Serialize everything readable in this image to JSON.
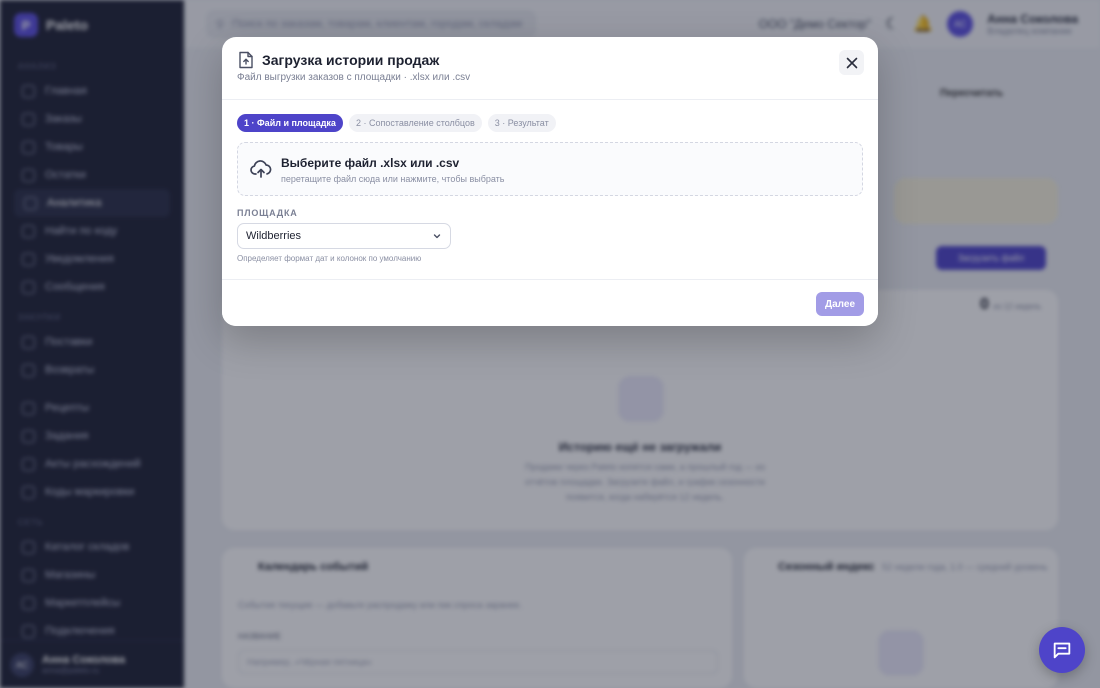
{
  "sidebar": {
    "brand": "Paleto",
    "sections": [
      "Анализ",
      "Закупки",
      "Сеть"
    ],
    "items_main": [
      "Главная",
      "Заказы",
      "Товары",
      "Остатки",
      "Аналитика",
      "Найти по коду",
      "Уведомления",
      "Сообщения"
    ],
    "items_purchases": [
      "Поставки",
      "Возвраты"
    ],
    "items_more": [
      "Рецепты",
      "Задания",
      "Акты расхождений",
      "Коды маркировки"
    ],
    "items_network": [
      "Каталог складов",
      "Магазины",
      "Маркетплейсы",
      "Подключения"
    ],
    "user_initials": "АС",
    "user_name": "Анна Соколова",
    "user_email": "anna@paleto.ru"
  },
  "topbar": {
    "search_placeholder": "Поиск по заказам, товарам, клиентам, городам, складам",
    "org": "ООО \"Демо Сектор\"",
    "user_initials": "АС",
    "user_name": "Анна Соколова",
    "user_role": "Владелец компании"
  },
  "background": {
    "recalc": "Пересчитать",
    "upload_button": "Загрузить файл",
    "empty_title": "Историю ещё не загружали",
    "empty_text": "Продажи через Paleto копятся сами, а прошлый год — из отчётов площадки. Загрузите файл, и график сезонности появится, когда наберётся 12 недель.",
    "counter": "0",
    "counter_suffix": "из 12 недель",
    "calendar_title": "Календарь событий",
    "calendar_sub": "События текущие — добавьте распродажу или пик спроса заранее.",
    "event_label": "НАЗВАНИЕ",
    "event_placeholder": "Например, «Чёрная пятница»",
    "season_title": "Сезонный индекс",
    "season_sub": "52 недели года, 1.0 — средний уровень"
  },
  "modal": {
    "title": "Загрузка истории продаж",
    "subtitle": "Файл выгрузки заказов с площадки · .xlsx или .csv",
    "steps": [
      "1 · Файл и площадка",
      "2 · Сопоставление столбцов",
      "3 · Результат"
    ],
    "drop_title": "Выберите файл .xlsx или .csv",
    "drop_hint": "перетащите файл сюда или нажмите, чтобы выбрать",
    "platform_label": "ПЛОЩАДКА",
    "platform_value": "Wildberries",
    "platform_note": "Определяет формат дат и колонок по умолчанию",
    "next_label": "Далее"
  },
  "colors": {
    "accent": "#4e44c9",
    "accent_disabled": "#a29ce6",
    "sidebar_bg": "#1e2134"
  }
}
